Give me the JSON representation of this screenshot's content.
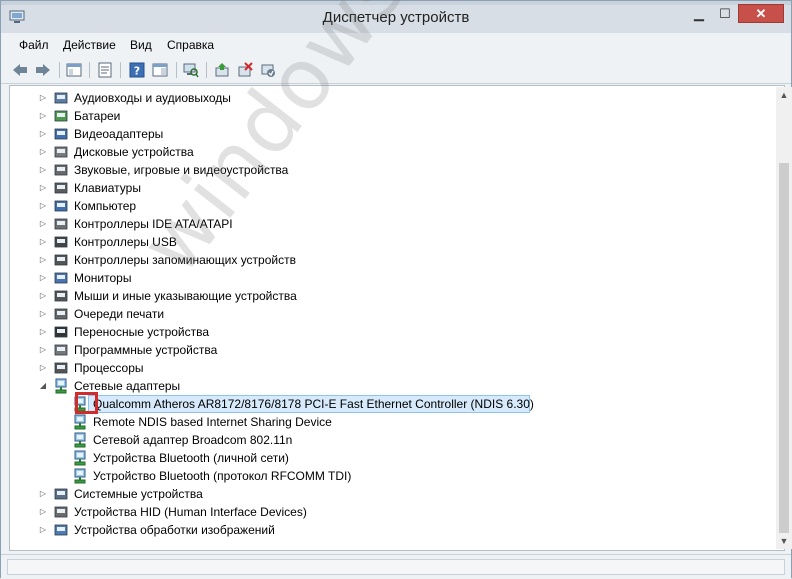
{
  "window": {
    "title": "Диспетчер устройств"
  },
  "menu": [
    "Файл",
    "Действие",
    "Вид",
    "Справка"
  ],
  "tree": {
    "categories": [
      {
        "label": "Аудиовходы и аудиовыходы",
        "icon": "speaker-icon"
      },
      {
        "label": "Батареи",
        "icon": "battery-icon"
      },
      {
        "label": "Видеоадаптеры",
        "icon": "display-adapter-icon"
      },
      {
        "label": "Дисковые устройства",
        "icon": "disk-drive-icon"
      },
      {
        "label": "Звуковые, игровые и видеоустройства",
        "icon": "sound-icon"
      },
      {
        "label": "Клавиатуры",
        "icon": "keyboard-icon"
      },
      {
        "label": "Компьютер",
        "icon": "computer-icon"
      },
      {
        "label": "Контроллеры IDE ATA/ATAPI",
        "icon": "ide-controller-icon"
      },
      {
        "label": "Контроллеры USB",
        "icon": "usb-icon"
      },
      {
        "label": "Контроллеры запоминающих устройств",
        "icon": "storage-controller-icon"
      },
      {
        "label": "Мониторы",
        "icon": "monitor-icon"
      },
      {
        "label": "Мыши и иные указывающие устройства",
        "icon": "mouse-icon"
      },
      {
        "label": "Очереди печати",
        "icon": "printer-icon"
      },
      {
        "label": "Переносные устройства",
        "icon": "portable-device-icon"
      },
      {
        "label": "Программные устройства",
        "icon": "software-device-icon"
      },
      {
        "label": "Процессоры",
        "icon": "processor-icon"
      },
      {
        "label": "Сетевые адаптеры",
        "icon": "network-adapter-icon",
        "expanded": true
      }
    ],
    "network_children": [
      {
        "label": "Qualcomm Atheros AR8172/8176/8178 PCI-E Fast Ethernet Controller (NDIS 6.30)",
        "selected": true
      },
      {
        "label": "Remote NDIS based Internet Sharing Device"
      },
      {
        "label": "Сетевой адаптер Broadcom 802.11n"
      },
      {
        "label": "Устройства Bluetooth (личной сети)"
      },
      {
        "label": "Устройство Bluetooth (протокол RFCOMM TDI)"
      }
    ],
    "after": [
      {
        "label": "Системные устройства",
        "icon": "system-device-icon"
      },
      {
        "label": "Устройства HID (Human Interface Devices)",
        "icon": "hid-icon"
      },
      {
        "label": "Устройства обработки изображений",
        "icon": "imaging-device-icon"
      }
    ]
  },
  "watermark": "windowstips.ru",
  "colors": {
    "selection": "#d6eafb",
    "highlight_box": "#d22b2b",
    "close_button": "#c7504a"
  }
}
